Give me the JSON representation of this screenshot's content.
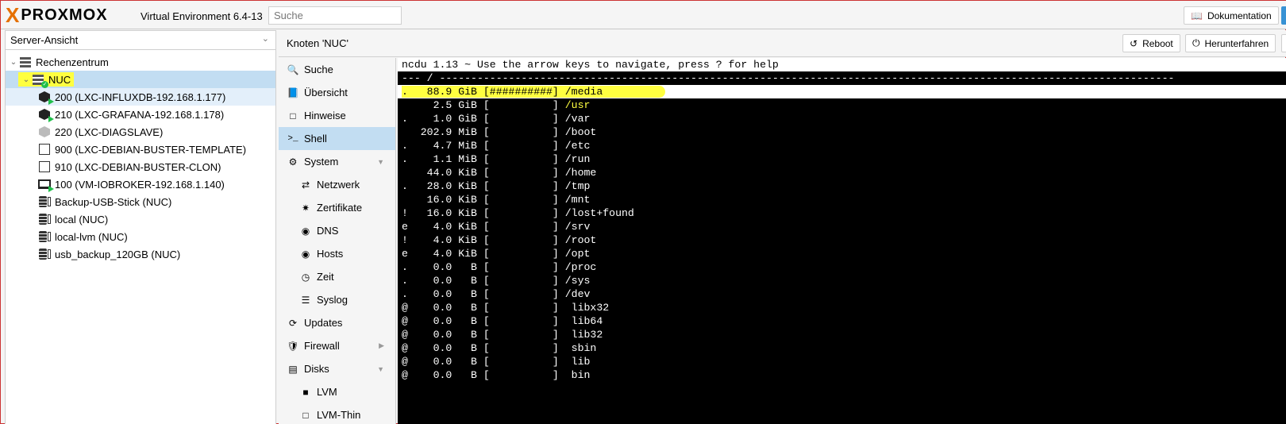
{
  "app": {
    "logo_x": "X",
    "logo_text": "PROXMOX",
    "version": "Virtual Environment 6.4-13",
    "search_placeholder": "Suche",
    "doc_button": "Dokumentation"
  },
  "sidebar": {
    "view": "Server-Ansicht",
    "datacenter": "Rechenzentrum",
    "node": "NUC",
    "items": [
      {
        "label": "200 (LXC-INFLUXDB-192.168.1.177)",
        "icon": "container-running-icon"
      },
      {
        "label": "210 (LXC-GRAFANA-192.168.1.178)",
        "icon": "container-running-icon"
      },
      {
        "label": "220 (LXC-DIAGSLAVE)",
        "icon": "container-stopped-icon"
      },
      {
        "label": "900 (LXC-DEBIAN-BUSTER-TEMPLATE)",
        "icon": "template-icon"
      },
      {
        "label": "910 (LXC-DEBIAN-BUSTER-CLON)",
        "icon": "template-icon"
      },
      {
        "label": "100 (VM-IOBROKER-192.168.1.140)",
        "icon": "vm-running-icon"
      },
      {
        "label": "Backup-USB-Stick (NUC)",
        "icon": "storage-icon"
      },
      {
        "label": "local (NUC)",
        "icon": "storage-icon"
      },
      {
        "label": "local-lvm (NUC)",
        "icon": "storage-icon"
      },
      {
        "label": "usb_backup_120GB (NUC)",
        "icon": "storage-icon"
      }
    ]
  },
  "panel": {
    "title": "Knoten 'NUC'",
    "reboot": "Reboot",
    "shutdown": "Herunterfahren"
  },
  "nav": [
    {
      "label": "Suche",
      "icon": "search-icon"
    },
    {
      "label": "Übersicht",
      "icon": "book-icon"
    },
    {
      "label": "Hinweise",
      "icon": "notes-icon"
    },
    {
      "label": "Shell",
      "icon": "terminal-icon"
    },
    {
      "label": "System",
      "icon": "cogs-icon"
    },
    {
      "label": "Netzwerk",
      "icon": "network-icon"
    },
    {
      "label": "Zertifikate",
      "icon": "certificate-icon"
    },
    {
      "label": "DNS",
      "icon": "globe-icon"
    },
    {
      "label": "Hosts",
      "icon": "globe-icon"
    },
    {
      "label": "Zeit",
      "icon": "clock-icon"
    },
    {
      "label": "Syslog",
      "icon": "list-icon"
    },
    {
      "label": "Updates",
      "icon": "refresh-icon"
    },
    {
      "label": "Firewall",
      "icon": "shield-icon"
    },
    {
      "label": "Disks",
      "icon": "hdd-icon"
    },
    {
      "label": "LVM",
      "icon": "square-icon"
    },
    {
      "label": "LVM-Thin",
      "icon": "square-outline-icon"
    }
  ],
  "terminal": {
    "header": "ncdu 1.13 ~ Use the arrow keys to navigate, press ? for help",
    "path_line": "--- / ---------------------------------------------------------------------------------------------------------------------",
    "rows": [
      {
        "flag": ".",
        "size": "88.9",
        "unit": "GiB",
        "bar": "##########",
        "name": "/media"
      },
      {
        "flag": " ",
        "size": "2.5",
        "unit": "GiB",
        "bar": "          ",
        "name": "/usr"
      },
      {
        "flag": ".",
        "size": "1.0",
        "unit": "GiB",
        "bar": "          ",
        "name": "/var"
      },
      {
        "flag": " ",
        "size": "202.9",
        "unit": "MiB",
        "bar": "          ",
        "name": "/boot"
      },
      {
        "flag": ".",
        "size": "4.7",
        "unit": "MiB",
        "bar": "          ",
        "name": "/etc"
      },
      {
        "flag": ".",
        "size": "1.1",
        "unit": "MiB",
        "bar": "          ",
        "name": "/run"
      },
      {
        "flag": " ",
        "size": "44.0",
        "unit": "KiB",
        "bar": "          ",
        "name": "/home"
      },
      {
        "flag": ".",
        "size": "28.0",
        "unit": "KiB",
        "bar": "          ",
        "name": "/tmp"
      },
      {
        "flag": " ",
        "size": "16.0",
        "unit": "KiB",
        "bar": "          ",
        "name": "/mnt"
      },
      {
        "flag": "!",
        "size": "16.0",
        "unit": "KiB",
        "bar": "          ",
        "name": "/lost+found"
      },
      {
        "flag": "e",
        "size": "4.0",
        "unit": "KiB",
        "bar": "          ",
        "name": "/srv"
      },
      {
        "flag": "!",
        "size": "4.0",
        "unit": "KiB",
        "bar": "          ",
        "name": "/root"
      },
      {
        "flag": "e",
        "size": "4.0",
        "unit": "KiB",
        "bar": "          ",
        "name": "/opt"
      },
      {
        "flag": ".",
        "size": "0.0",
        "unit": "B",
        "bar": "          ",
        "name": "/proc"
      },
      {
        "flag": ".",
        "size": "0.0",
        "unit": "B",
        "bar": "          ",
        "name": "/sys"
      },
      {
        "flag": ".",
        "size": "0.0",
        "unit": "B",
        "bar": "          ",
        "name": "/dev"
      },
      {
        "flag": "@",
        "size": "0.0",
        "unit": "B",
        "bar": "          ",
        "name": " libx32"
      },
      {
        "flag": "@",
        "size": "0.0",
        "unit": "B",
        "bar": "          ",
        "name": " lib64"
      },
      {
        "flag": "@",
        "size": "0.0",
        "unit": "B",
        "bar": "          ",
        "name": " lib32"
      },
      {
        "flag": "@",
        "size": "0.0",
        "unit": "B",
        "bar": "          ",
        "name": " sbin"
      },
      {
        "flag": "@",
        "size": "0.0",
        "unit": "B",
        "bar": "          ",
        "name": " lib"
      },
      {
        "flag": "@",
        "size": "0.0",
        "unit": "B",
        "bar": "          ",
        "name": " bin"
      }
    ]
  },
  "colors": {
    "accent_orange": "#e57000",
    "selection_blue": "#c2ddf2",
    "highlight_yellow": "#ffff40",
    "running_green": "#21bf4b"
  }
}
